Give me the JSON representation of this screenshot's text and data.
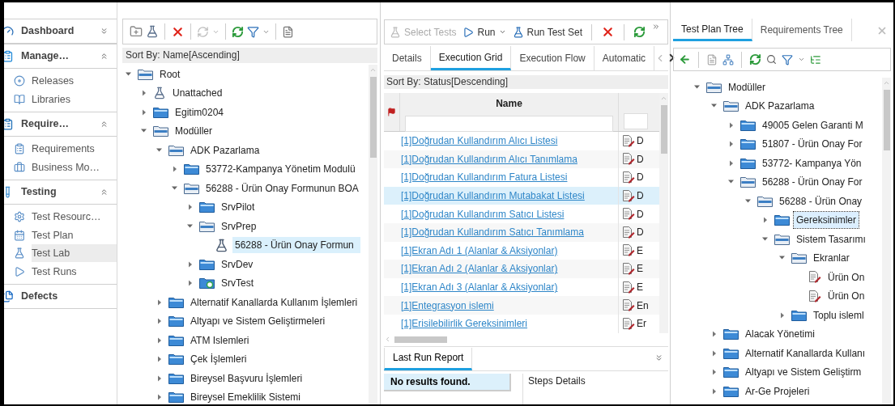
{
  "sidebar": {
    "sections": [
      {
        "label": "Dashboard",
        "expanded": false
      },
      {
        "label": "Manage…",
        "expanded": true,
        "items": [
          {
            "label": "Releases",
            "selected": false
          },
          {
            "label": "Libraries",
            "selected": false
          }
        ]
      },
      {
        "label": "Require…",
        "expanded": true,
        "items": [
          {
            "label": "Requirements",
            "selected": false
          },
          {
            "label": "Business Mo…",
            "selected": false
          }
        ]
      },
      {
        "label": "Testing",
        "expanded": true,
        "items": [
          {
            "label": "Test Resourc…",
            "selected": false
          },
          {
            "label": "Test Plan",
            "selected": false
          },
          {
            "label": "Test Lab",
            "selected": true
          },
          {
            "label": "Test Runs",
            "selected": false
          }
        ]
      },
      {
        "label": "Defects"
      }
    ]
  },
  "test_sets_tree": {
    "sort_label": "Sort By: Name[Ascending]",
    "nodes": [
      {
        "label": "Root",
        "kind": "folder",
        "expanded": true,
        "selected": false,
        "children": [
          {
            "label": "Unattached",
            "kind": "unattached",
            "expanded": false,
            "selected": false
          },
          {
            "label": "Egitim0204",
            "kind": "folder",
            "expanded": false,
            "selected": false
          },
          {
            "label": "Modüller",
            "kind": "folder",
            "expanded": true,
            "selected": false,
            "children": [
              {
                "label": "ADK Pazarlama",
                "kind": "folder",
                "expanded": true,
                "selected": false,
                "children": [
                  {
                    "label": "53772-Kampanya Yönetim Modulü",
                    "kind": "folder",
                    "expanded": false,
                    "selected": false
                  },
                  {
                    "label": "56288 - Ürün Onay Formunun BOA",
                    "kind": "folder",
                    "expanded": true,
                    "selected": false,
                    "children": [
                      {
                        "label": "SrvPilot",
                        "kind": "folder",
                        "expanded": false,
                        "selected": false
                      },
                      {
                        "label": "SrvPrep",
                        "kind": "folder",
                        "expanded": true,
                        "selected": false,
                        "children": [
                          {
                            "label": "56288 - Ürün Onay Formun",
                            "kind": "test-set",
                            "selected": true
                          }
                        ]
                      },
                      {
                        "label": "SrvDev",
                        "kind": "folder",
                        "expanded": false,
                        "selected": false
                      },
                      {
                        "label": "SrvTest",
                        "kind": "test-folder",
                        "expanded": false,
                        "selected": false
                      }
                    ]
                  }
                ]
              },
              {
                "label": "Alternatif Kanallarda Kullanım İşlemleri",
                "kind": "folder",
                "expanded": false,
                "selected": false
              },
              {
                "label": "Altyapı ve Sistem Geliştirmeleri",
                "kind": "folder",
                "expanded": false,
                "selected": false
              },
              {
                "label": "ATM Islemleri",
                "kind": "folder",
                "expanded": false,
                "selected": false
              },
              {
                "label": "Çek İşlemleri",
                "kind": "folder",
                "expanded": false,
                "selected": false
              },
              {
                "label": "Bireysel Başvuru İşlemleri",
                "kind": "folder",
                "expanded": false,
                "selected": false
              },
              {
                "label": "Bireysel Emeklilik Sistemi",
                "kind": "folder",
                "expanded": false,
                "selected": false
              }
            ]
          }
        ]
      }
    ]
  },
  "execution": {
    "toolbar": [
      {
        "label": "Select Tests",
        "kind": "select",
        "disabled": true
      },
      {
        "label": "Run",
        "kind": "run",
        "disabled": false
      },
      {
        "label": "Run Test Set",
        "kind": "run-set",
        "disabled": false
      }
    ],
    "tabs": [
      {
        "label": "Details",
        "selected": false
      },
      {
        "label": "Execution Grid",
        "selected": true
      },
      {
        "label": "Execution Flow",
        "selected": false
      },
      {
        "label": "Automatic",
        "selected": false
      }
    ],
    "sort_label": "Sort By: Status[Descending]",
    "grid": {
      "columns": [
        "Name"
      ],
      "rows": [
        {
          "name": "[1]Doğrudan Kullandırım Alıcı Listesi",
          "column_2": "D",
          "selected": false
        },
        {
          "name": "[1]Doğrudan Kullandırım Alıcı Tanımlama",
          "column_2": "D",
          "selected": false
        },
        {
          "name": "[1]Doğrudan Kullandırım Fatura Listesi",
          "column_2": "D",
          "selected": false
        },
        {
          "name": "[1]Doğrudan Kullandırım Mutabakat Listesi",
          "column_2": "D",
          "selected": true
        },
        {
          "name": "[1]Doğrudan Kullandırım Satıcı Listesi",
          "column_2": "D",
          "selected": false
        },
        {
          "name": "[1]Doğrudan Kullandırım Satıcı Tanımlama",
          "column_2": "D",
          "selected": false
        },
        {
          "name": "[1]Ekran Adı 1 (Alanlar & Aksiyonlar)",
          "column_2": "E",
          "selected": false
        },
        {
          "name": "[1]Ekran Adı 2 (Alanlar & Aksiyonlar)",
          "column_2": "E",
          "selected": false
        },
        {
          "name": "[1]Ekran Adı 3 (Alanlar & Aksiyonlar)",
          "column_2": "E",
          "selected": false
        },
        {
          "name": "[1]Entegrasyon islemi",
          "column_2": "En",
          "selected": false
        },
        {
          "name": "[1]Erisilebilirlik Gereksinimleri",
          "column_2": "Er",
          "selected": false
        }
      ]
    },
    "bottom": {
      "tabs": [
        {
          "label": "Last Run Report",
          "selected": true
        }
      ],
      "message": "No results found.",
      "steps_label": "Steps Details"
    }
  },
  "right_pane": {
    "tabs": [
      {
        "label": "Test Plan Tree",
        "selected": true
      },
      {
        "label": "Requirements Tree",
        "selected": false
      }
    ],
    "nodes": [
      {
        "label": "Modüller",
        "kind": "folder",
        "expanded": true,
        "selected": false,
        "children": [
          {
            "label": "ADK Pazarlama",
            "kind": "folder",
            "expanded": true,
            "selected": false,
            "children": [
              {
                "label": "49005 Gelen Garanti M",
                "kind": "folder",
                "expanded": false,
                "selected": false
              },
              {
                "label": "51807 - Ürün Onay For",
                "kind": "folder",
                "expanded": false,
                "selected": false
              },
              {
                "label": "53772- Kampanya Yön",
                "kind": "folder",
                "expanded": false,
                "selected": false
              },
              {
                "label": "56288 - Ürün Onay For",
                "kind": "folder",
                "expanded": true,
                "selected": false,
                "children": [
                  {
                    "label": "56288 - Ürün Onay",
                    "kind": "folder",
                    "expanded": true,
                    "selected": false,
                    "children": [
                      {
                        "label": "Gereksinimler",
                        "kind": "folder",
                        "expanded": false,
                        "selected": true
                      },
                      {
                        "label": "Sistem Tasarımı",
                        "kind": "folder",
                        "expanded": true,
                        "selected": false,
                        "children": [
                          {
                            "label": "Ekranlar",
                            "kind": "folder",
                            "expanded": true,
                            "selected": false,
                            "children": [
                              {
                                "label": "Ürün On",
                                "kind": "test",
                                "selected": false
                              },
                              {
                                "label": "Ürün On",
                                "kind": "test",
                                "selected": false
                              }
                            ]
                          },
                          {
                            "label": "Toplu isleml",
                            "kind": "folder",
                            "expanded": false,
                            "selected": false
                          }
                        ]
                      }
                    ]
                  }
                ]
              }
            ]
          },
          {
            "label": "Alacak Yönetimi",
            "kind": "folder",
            "expanded": false,
            "selected": false
          },
          {
            "label": "Alternatif Kanallarda Kullanı",
            "kind": "folder",
            "expanded": false,
            "selected": false
          },
          {
            "label": "Altyapı ve Sistem Geliştirm",
            "kind": "folder",
            "expanded": false,
            "selected": false
          },
          {
            "label": "Ar-Ge Projeleri",
            "kind": "folder",
            "expanded": false,
            "selected": false
          }
        ]
      }
    ]
  }
}
